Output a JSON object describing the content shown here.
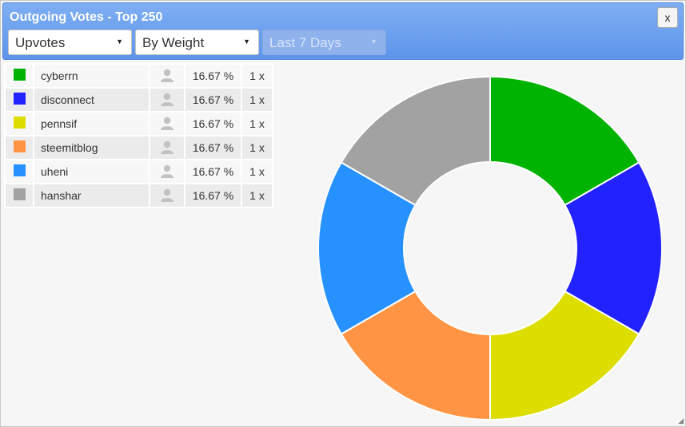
{
  "window": {
    "title": "Outgoing Votes - Top 250",
    "close_label": "x"
  },
  "filters": {
    "type": {
      "value": "Upvotes"
    },
    "sort": {
      "value": "By Weight"
    },
    "period": {
      "value": "Last 7 Days",
      "disabled": true
    }
  },
  "legend": [
    {
      "name": "cyberrn",
      "color": "#00b300",
      "percent": "16.67 %",
      "count": "1 x",
      "icon": "user-icon"
    },
    {
      "name": "disconnect",
      "color": "#2222ff",
      "percent": "16.67 %",
      "count": "1 x",
      "icon": "user-icon"
    },
    {
      "name": "pennsif",
      "color": "#dddd00",
      "percent": "16.67 %",
      "count": "1 x",
      "icon": "user-icon"
    },
    {
      "name": "steemitblog",
      "color": "#ff9544",
      "percent": "16.67 %",
      "count": "1 x",
      "icon": "user-icon"
    },
    {
      "name": "uheni",
      "color": "#2792ff",
      "percent": "16.67 %",
      "count": "1 x",
      "icon": "user-icon"
    },
    {
      "name": "hanshar",
      "color": "#a2a2a2",
      "percent": "16.67 %",
      "count": "1 x",
      "icon": "user-icon"
    }
  ],
  "chart_data": {
    "type": "pie",
    "donut": true,
    "categories": [
      "cyberrn",
      "disconnect",
      "pennsif",
      "steemitblog",
      "uheni",
      "hanshar"
    ],
    "values": [
      16.67,
      16.67,
      16.67,
      16.67,
      16.67,
      16.67
    ],
    "colors": [
      "#00b300",
      "#2222ff",
      "#dddd00",
      "#ff9544",
      "#2792ff",
      "#a2a2a2"
    ],
    "start": "top, clockwise"
  }
}
